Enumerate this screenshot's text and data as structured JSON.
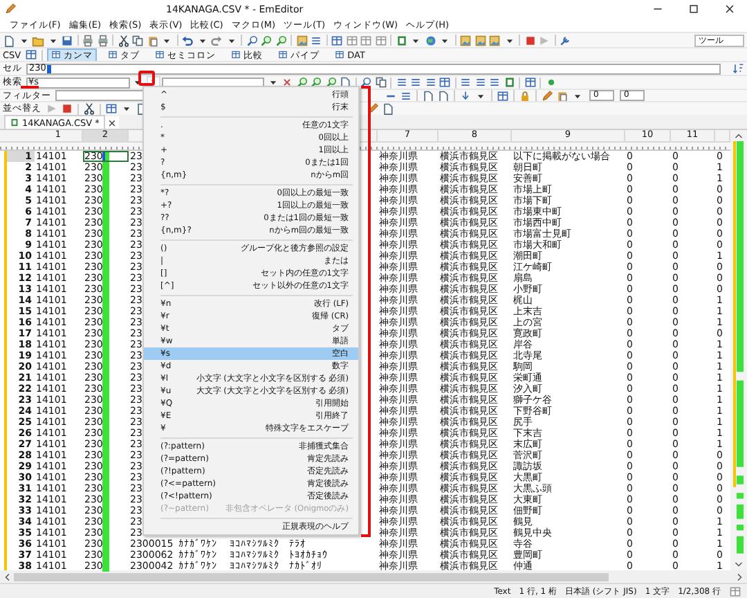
{
  "window": {
    "title": "14KANAGA.CSV * - EmEditor"
  },
  "menu": [
    "ファイル(F)",
    "編集(E)",
    "検索(S)",
    "表示(V)",
    "比較(C)",
    "マクロ(M)",
    "ツール(T)",
    "ウィンドウ(W)",
    "ヘルプ(H)"
  ],
  "toolbar": {
    "dropdown": "ツール"
  },
  "csv_bar": {
    "label": "CSV",
    "modes": [
      {
        "label": "カンマ",
        "selected": true
      },
      {
        "label": "タブ",
        "selected": false
      },
      {
        "label": "セミコロン",
        "selected": false
      },
      {
        "label": "比較",
        "selected": false
      },
      {
        "label": "パイプ",
        "selected": false
      },
      {
        "label": "DAT",
        "selected": false
      }
    ]
  },
  "cell_bar": {
    "label": "セル",
    "value": "230"
  },
  "search_bar": {
    "label": "検索",
    "value": "¥s"
  },
  "filter_bar": {
    "label": "フィルター",
    "spin_1": "0",
    "spin_2": "0"
  },
  "sort_bar": {
    "label": "並べ替え"
  },
  "tabs": [
    {
      "label": "14KANAGA.CSV *",
      "selected": true
    }
  ],
  "table": {
    "columns": [
      {
        "label": "1",
        "selected": false
      },
      {
        "label": "2",
        "selected": true
      },
      {},
      {},
      {},
      {},
      {
        "label": "7",
        "selected": false
      },
      {
        "label": "8",
        "selected": false
      },
      {
        "label": "9",
        "selected": false
      },
      {
        "label": "10",
        "selected": false
      },
      {
        "label": "11",
        "selected": false
      },
      {}
    ],
    "rows": [
      {
        "number": "1",
        "selected": true,
        "match": true,
        "cells": {
          "1": "14101",
          "2": "230",
          "3": "23",
          "7": "神奈川県",
          "8": "横浜市鶴見区",
          "9": "以下に掲載がない場合",
          "10": "0",
          "11": "0",
          "12": "0"
        }
      },
      {
        "number": "2",
        "selected": false,
        "match": true,
        "cells": {
          "1": "14101",
          "2": "230",
          "3": "23",
          "7": "神奈川県",
          "8": "横浜市鶴見区",
          "9": "朝日町",
          "10": "0",
          "11": "0",
          "12": "1"
        }
      },
      {
        "number": "3",
        "selected": false,
        "match": true,
        "cells": {
          "1": "14101",
          "2": "230",
          "3": "23",
          "7": "神奈川県",
          "8": "横浜市鶴見区",
          "9": "安善町",
          "10": "0",
          "11": "0",
          "12": "1"
        }
      },
      {
        "number": "4",
        "selected": false,
        "match": true,
        "cells": {
          "1": "14101",
          "2": "230",
          "3": "23",
          "7": "神奈川県",
          "8": "横浜市鶴見区",
          "9": "市場上町",
          "10": "0",
          "11": "0",
          "12": "0"
        }
      },
      {
        "number": "5",
        "selected": false,
        "match": true,
        "cells": {
          "1": "14101",
          "2": "230",
          "3": "23",
          "7": "神奈川県",
          "8": "横浜市鶴見区",
          "9": "市場下町",
          "10": "0",
          "11": "0",
          "12": "0"
        }
      },
      {
        "number": "6",
        "selected": false,
        "match": true,
        "cells": {
          "1": "14101",
          "2": "230",
          "3": "23",
          "7": "神奈川県",
          "8": "横浜市鶴見区",
          "9": "市場東中町",
          "10": "0",
          "11": "0",
          "12": "0"
        }
      },
      {
        "number": "7",
        "selected": false,
        "match": true,
        "cells": {
          "1": "14101",
          "2": "230",
          "3": "23",
          "7": "神奈川県",
          "8": "横浜市鶴見区",
          "9": "市場西中町",
          "10": "0",
          "11": "0",
          "12": "0"
        }
      },
      {
        "number": "8",
        "selected": false,
        "match": true,
        "cells": {
          "1": "14101",
          "2": "230",
          "3": "23",
          "7": "神奈川県",
          "8": "横浜市鶴見区",
          "9": "市場富士見町",
          "10": "0",
          "11": "0",
          "12": "0"
        }
      },
      {
        "number": "9",
        "selected": false,
        "match": true,
        "cells": {
          "1": "14101",
          "2": "230",
          "3": "23",
          "7": "神奈川県",
          "8": "横浜市鶴見区",
          "9": "市場大和町",
          "10": "0",
          "11": "0",
          "12": "0"
        }
      },
      {
        "number": "10",
        "selected": false,
        "match": true,
        "cells": {
          "1": "14101",
          "2": "230",
          "3": "23",
          "7": "神奈川県",
          "8": "横浜市鶴見区",
          "9": "潮田町",
          "10": "0",
          "11": "0",
          "12": "1"
        }
      },
      {
        "number": "11",
        "selected": false,
        "match": true,
        "cells": {
          "1": "14101",
          "2": "230",
          "3": "23",
          "7": "神奈川県",
          "8": "横浜市鶴見区",
          "9": "江ケ崎町",
          "10": "0",
          "11": "0",
          "12": "0"
        }
      },
      {
        "number": "12",
        "selected": false,
        "match": true,
        "cells": {
          "1": "14101",
          "2": "230",
          "3": "23",
          "7": "神奈川県",
          "8": "横浜市鶴見区",
          "9": "扇島",
          "10": "0",
          "11": "0",
          "12": "0"
        }
      },
      {
        "number": "13",
        "selected": false,
        "match": true,
        "cells": {
          "1": "14101",
          "2": "230",
          "3": "23",
          "7": "神奈川県",
          "8": "横浜市鶴見区",
          "9": "小野町",
          "10": "0",
          "11": "0",
          "12": "0"
        }
      },
      {
        "number": "14",
        "selected": false,
        "match": true,
        "cells": {
          "1": "14101",
          "2": "230",
          "3": "23",
          "7": "神奈川県",
          "8": "横浜市鶴見区",
          "9": "梶山",
          "10": "0",
          "11": "0",
          "12": "1"
        }
      },
      {
        "number": "15",
        "selected": false,
        "match": true,
        "cells": {
          "1": "14101",
          "2": "230",
          "3": "23",
          "7": "神奈川県",
          "8": "横浜市鶴見区",
          "9": "上末吉",
          "10": "0",
          "11": "0",
          "12": "1"
        }
      },
      {
        "number": "16",
        "selected": false,
        "match": true,
        "cells": {
          "1": "14101",
          "2": "230",
          "3": "23",
          "7": "神奈川県",
          "8": "横浜市鶴見区",
          "9": "上の宮",
          "10": "0",
          "11": "0",
          "12": "1"
        }
      },
      {
        "number": "17",
        "selected": false,
        "match": true,
        "cells": {
          "1": "14101",
          "2": "230",
          "3": "23",
          "7": "神奈川県",
          "8": "横浜市鶴見区",
          "9": "寛政町",
          "10": "0",
          "11": "0",
          "12": "0"
        }
      },
      {
        "number": "18",
        "selected": false,
        "match": true,
        "cells": {
          "1": "14101",
          "2": "230",
          "3": "23",
          "7": "神奈川県",
          "8": "横浜市鶴見区",
          "9": "岸谷",
          "10": "0",
          "11": "0",
          "12": "1"
        }
      },
      {
        "number": "19",
        "selected": false,
        "match": true,
        "cells": {
          "1": "14101",
          "2": "230",
          "3": "23",
          "7": "神奈川県",
          "8": "横浜市鶴見区",
          "9": "北寺尾",
          "10": "0",
          "11": "0",
          "12": "1"
        }
      },
      {
        "number": "20",
        "selected": false,
        "match": true,
        "cells": {
          "1": "14101",
          "2": "230",
          "3": "23",
          "7": "神奈川県",
          "8": "横浜市鶴見区",
          "9": "駒岡",
          "10": "0",
          "11": "0",
          "12": "1"
        }
      },
      {
        "number": "21",
        "selected": false,
        "match": true,
        "cells": {
          "1": "14101",
          "2": "230",
          "3": "23",
          "7": "神奈川県",
          "8": "横浜市鶴見区",
          "9": "栄町通",
          "10": "0",
          "11": "0",
          "12": "1"
        }
      },
      {
        "number": "22",
        "selected": false,
        "match": true,
        "cells": {
          "1": "14101",
          "2": "230",
          "3": "23",
          "7": "神奈川県",
          "8": "横浜市鶴見区",
          "9": "汐入町",
          "10": "0",
          "11": "0",
          "12": "1"
        }
      },
      {
        "number": "23",
        "selected": false,
        "match": true,
        "cells": {
          "1": "14101",
          "2": "230",
          "3": "23",
          "7": "神奈川県",
          "8": "横浜市鶴見区",
          "9": "獅子ケ谷",
          "10": "0",
          "11": "0",
          "12": "1"
        }
      },
      {
        "number": "24",
        "selected": false,
        "match": true,
        "cells": {
          "1": "14101",
          "2": "230",
          "3": "23",
          "7": "神奈川県",
          "8": "横浜市鶴見区",
          "9": "下野谷町",
          "10": "0",
          "11": "0",
          "12": "1"
        }
      },
      {
        "number": "25",
        "selected": false,
        "match": true,
        "cells": {
          "1": "14101",
          "2": "230",
          "3": "23",
          "7": "神奈川県",
          "8": "横浜市鶴見区",
          "9": "尻手",
          "10": "0",
          "11": "0",
          "12": "1"
        }
      },
      {
        "number": "26",
        "selected": false,
        "match": true,
        "cells": {
          "1": "14101",
          "2": "230",
          "3": "23",
          "7": "神奈川県",
          "8": "横浜市鶴見区",
          "9": "下末吉",
          "10": "0",
          "11": "0",
          "12": "1"
        }
      },
      {
        "number": "27",
        "selected": false,
        "match": true,
        "cells": {
          "1": "14101",
          "2": "230",
          "3": "23",
          "7": "神奈川県",
          "8": "横浜市鶴見区",
          "9": "末広町",
          "10": "0",
          "11": "0",
          "12": "1"
        }
      },
      {
        "number": "28",
        "selected": false,
        "match": true,
        "cells": {
          "1": "14101",
          "2": "230",
          "3": "23",
          "7": "神奈川県",
          "8": "横浜市鶴見区",
          "9": "菅沢町",
          "10": "0",
          "11": "0",
          "12": "0"
        }
      },
      {
        "number": "29",
        "selected": false,
        "match": true,
        "cells": {
          "1": "14101",
          "2": "230",
          "3": "23",
          "7": "神奈川県",
          "8": "横浜市鶴見区",
          "9": "諏訪坂",
          "10": "0",
          "11": "0",
          "12": "0"
        }
      },
      {
        "number": "30",
        "selected": false,
        "match": true,
        "cells": {
          "1": "14101",
          "2": "230",
          "3": "23",
          "7": "神奈川県",
          "8": "横浜市鶴見区",
          "9": "大黒町",
          "10": "0",
          "11": "0",
          "12": "0"
        }
      },
      {
        "number": "31",
        "selected": false,
        "match": true,
        "cells": {
          "1": "14101",
          "2": "230",
          "3": "23",
          "7": "神奈川県",
          "8": "横浜市鶴見区",
          "9": "大黒ふ頭",
          "10": "0",
          "11": "0",
          "12": "0"
        }
      },
      {
        "number": "32",
        "selected": false,
        "match": true,
        "cells": {
          "1": "14101",
          "2": "230",
          "3": "23",
          "7": "神奈川県",
          "8": "横浜市鶴見区",
          "9": "大東町",
          "10": "0",
          "11": "0",
          "12": "0"
        }
      },
      {
        "number": "33",
        "selected": false,
        "match": true,
        "cells": {
          "1": "14101",
          "2": "230",
          "3": "23",
          "7": "神奈川県",
          "8": "横浜市鶴見区",
          "9": "佃野町",
          "10": "0",
          "11": "0",
          "12": "0"
        }
      },
      {
        "number": "34",
        "selected": false,
        "match": true,
        "cells": {
          "1": "14101",
          "2": "230",
          "3": "23",
          "7": "神奈川県",
          "8": "横浜市鶴見区",
          "9": "鶴見",
          "10": "0",
          "11": "0",
          "12": "1"
        }
      },
      {
        "number": "35",
        "selected": false,
        "match": true,
        "cells": {
          "1": "14101",
          "2": "230",
          "3": "23",
          "7": "神奈川県",
          "8": "横浜市鶴見区",
          "9": "鶴見中央",
          "10": "0",
          "11": "0",
          "12": "1"
        }
      },
      {
        "number": "36",
        "selected": false,
        "match": true,
        "cells": {
          "1": "14101",
          "2": "230",
          "3": "2300015",
          "4": "ｶﾅｶﾞﾜｹﾝ",
          "5": "ﾖｺﾊﾏｼﾂﾙﾐｸ",
          "6": "ﾃﾗｵ",
          "7": "神奈川県",
          "8": "横浜市鶴見区",
          "9": "寺谷",
          "10": "0",
          "11": "0",
          "12": "1"
        }
      },
      {
        "number": "37",
        "selected": false,
        "match": true,
        "cells": {
          "1": "14101",
          "2": "230",
          "3": "2300062",
          "4": "ｶﾅｶﾞﾜｹﾝ",
          "5": "ﾖｺﾊﾏｼﾂﾙﾐｸ",
          "6": "ﾄﾖｵｶﾁｮｳ",
          "7": "神奈川県",
          "8": "横浜市鶴見区",
          "9": "豊岡町",
          "10": "0",
          "11": "0",
          "12": "0"
        }
      },
      {
        "number": "38",
        "selected": false,
        "match": true,
        "cells": {
          "1": "14101",
          "2": "230",
          "3": "2300042",
          "4": "ｶﾅｶﾞﾜｹﾝ",
          "5": "ﾖｺﾊﾏｼﾂﾙﾐｸ",
          "6": "ﾅｶﾄﾞｵﾘ",
          "7": "神奈川県",
          "8": "横浜市鶴見区",
          "9": "仲通",
          "10": "0",
          "11": "0",
          "12": "1"
        }
      }
    ]
  },
  "regex_menu": {
    "items": [
      {
        "kind": "item",
        "pattern": "^",
        "description": "行頭",
        "selected": false,
        "disabled": false
      },
      {
        "kind": "item",
        "pattern": "$",
        "description": "行末",
        "selected": false,
        "disabled": false
      },
      {
        "kind": "separator"
      },
      {
        "kind": "item",
        "pattern": ".",
        "description": "任意の1文字",
        "selected": false,
        "disabled": false
      },
      {
        "kind": "item",
        "pattern": "*",
        "description": "0回以上",
        "selected": false,
        "disabled": false
      },
      {
        "kind": "item",
        "pattern": "+",
        "description": "1回以上",
        "selected": false,
        "disabled": false
      },
      {
        "kind": "item",
        "pattern": "?",
        "description": "0または1回",
        "selected": false,
        "disabled": false
      },
      {
        "kind": "item",
        "pattern": "{n,m}",
        "description": "nからm回",
        "selected": false,
        "disabled": false
      },
      {
        "kind": "separator"
      },
      {
        "kind": "item",
        "pattern": "*?",
        "description": "0回以上の最短一致",
        "selected": false,
        "disabled": false
      },
      {
        "kind": "item",
        "pattern": "+?",
        "description": "1回以上の最短一致",
        "selected": false,
        "disabled": false
      },
      {
        "kind": "item",
        "pattern": "??",
        "description": "0または1回の最短一致",
        "selected": false,
        "disabled": false
      },
      {
        "kind": "item",
        "pattern": "{n,m}?",
        "description": "nからm回の最短一致",
        "selected": false,
        "disabled": false
      },
      {
        "kind": "separator"
      },
      {
        "kind": "item",
        "pattern": "()",
        "description": "グループ化と後方参照の設定",
        "selected": false,
        "disabled": false
      },
      {
        "kind": "item",
        "pattern": "|",
        "description": "または",
        "selected": false,
        "disabled": false
      },
      {
        "kind": "item",
        "pattern": "[]",
        "description": "セット内の任意の1文字",
        "selected": false,
        "disabled": false
      },
      {
        "kind": "item",
        "pattern": "[^]",
        "description": "セット以外の任意の1文字",
        "selected": false,
        "disabled": false
      },
      {
        "kind": "separator"
      },
      {
        "kind": "item",
        "pattern": "¥n",
        "description": "改行 (LF)",
        "selected": false,
        "disabled": false
      },
      {
        "kind": "item",
        "pattern": "¥r",
        "description": "復帰 (CR)",
        "selected": false,
        "disabled": false
      },
      {
        "kind": "item",
        "pattern": "¥t",
        "description": "タブ",
        "selected": false,
        "disabled": false
      },
      {
        "kind": "item",
        "pattern": "¥w",
        "description": "単語",
        "selected": false,
        "disabled": false
      },
      {
        "kind": "item",
        "pattern": "¥s",
        "description": "空白",
        "selected": true,
        "disabled": false
      },
      {
        "kind": "item",
        "pattern": "¥d",
        "description": "数字",
        "selected": false,
        "disabled": false
      },
      {
        "kind": "item",
        "pattern": "¥l",
        "description": "小文字 (大文字と小文字を区別する 必須)",
        "selected": false,
        "disabled": false
      },
      {
        "kind": "item",
        "pattern": "¥u",
        "description": "大文字 (大文字と小文字を区別する 必須)",
        "selected": false,
        "disabled": false
      },
      {
        "kind": "item",
        "pattern": "¥Q",
        "description": "引用開始",
        "selected": false,
        "disabled": false
      },
      {
        "kind": "item",
        "pattern": "¥E",
        "description": "引用終了",
        "selected": false,
        "disabled": false
      },
      {
        "kind": "item",
        "pattern": "¥",
        "description": "特殊文字をエスケープ",
        "selected": false,
        "disabled": false
      },
      {
        "kind": "separator"
      },
      {
        "kind": "item",
        "pattern": "(?:pattern)",
        "description": "非捕獲式集合",
        "selected": false,
        "disabled": false
      },
      {
        "kind": "item",
        "pattern": "(?=pattern)",
        "description": "肯定先読み",
        "selected": false,
        "disabled": false
      },
      {
        "kind": "item",
        "pattern": "(?!pattern)",
        "description": "否定先読み",
        "selected": false,
        "disabled": false
      },
      {
        "kind": "item",
        "pattern": "(?<=pattern)",
        "description": "肯定後読み",
        "selected": false,
        "disabled": false
      },
      {
        "kind": "item",
        "pattern": "(?<!pattern)",
        "description": "否定後読み",
        "selected": false,
        "disabled": false
      },
      {
        "kind": "item",
        "pattern": "(?~pattern)",
        "description": "非包含オペレータ (Onigmoのみ)",
        "selected": false,
        "disabled": true
      },
      {
        "kind": "separator"
      },
      {
        "kind": "item",
        "description": "正規表現のヘルプ",
        "selected": false,
        "disabled": false
      }
    ]
  },
  "annotations": [
    {
      "kind": "frame"
    },
    {
      "kind": "underline"
    },
    {
      "kind": "bracket"
    }
  ],
  "status_bar": [
    "Text",
    "1 行, 1 桁",
    "日本語 (シフト JIS)",
    "1 文字",
    "1/2,308 行"
  ]
}
